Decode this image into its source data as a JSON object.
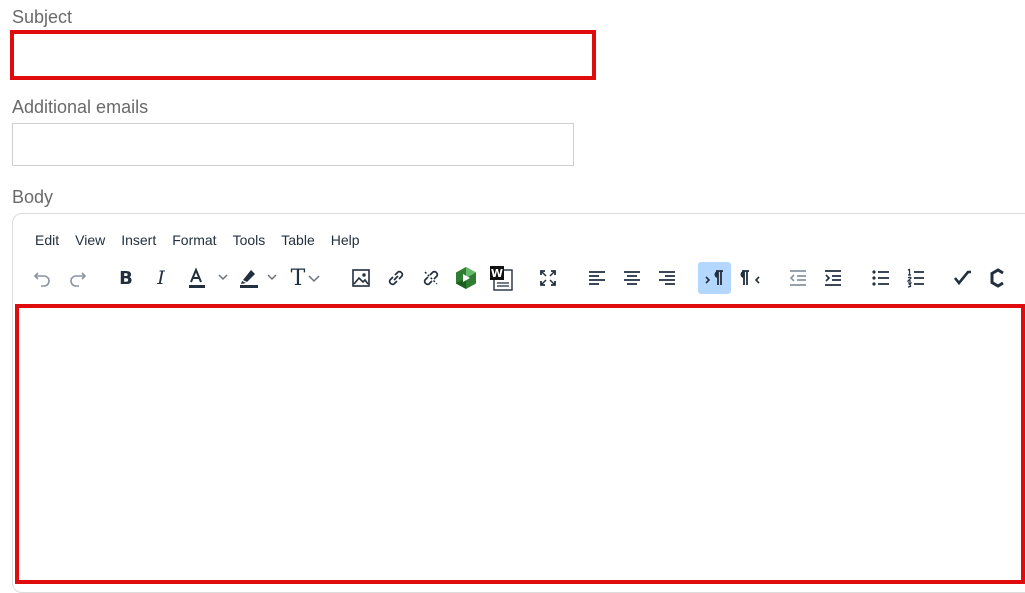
{
  "form": {
    "subject_label": "Subject",
    "subject_value": "",
    "additional_emails_label": "Additional emails",
    "additional_emails_value": "",
    "body_label": "Body"
  },
  "editor": {
    "menu": [
      "Edit",
      "View",
      "Insert",
      "Format",
      "Tools",
      "Table",
      "Help"
    ],
    "toolbar": {
      "font_size_glyph": "T",
      "word_glyph": "W",
      "active_button": "ltr-button"
    },
    "body_content": ""
  },
  "colors": {
    "highlight_border": "#e00b0b",
    "active_button_bg": "#b4d7ff",
    "text_dark": "#222f3e",
    "label_gray": "#6a6a6a"
  }
}
